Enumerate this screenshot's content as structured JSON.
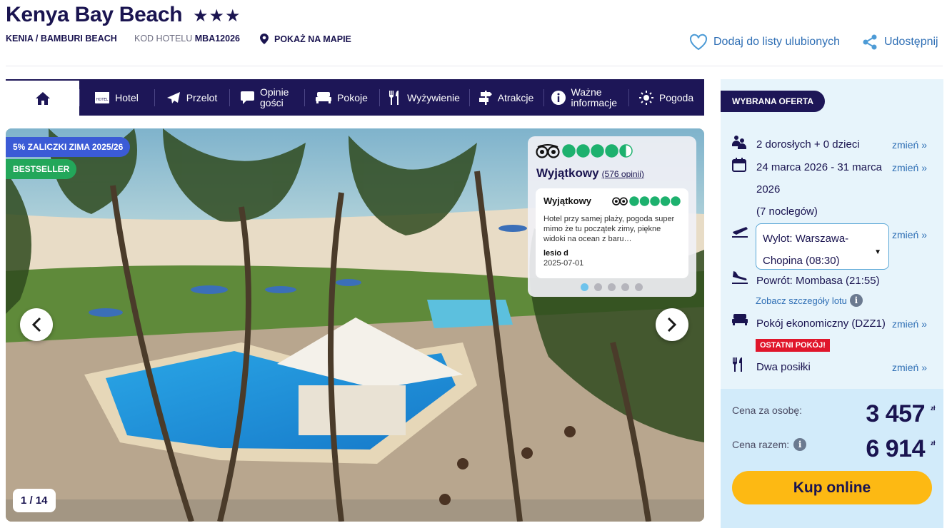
{
  "header": {
    "title": "Kenya Bay Beach",
    "stars": "★★★",
    "location": "KENIA / BAMBURI BEACH",
    "code_label": "KOD HOTELU",
    "code_value": "MBA12026",
    "map_label": "POKAŻ NA MAPIE",
    "favorite_label": "Dodaj do listy ulubionych",
    "share_label": "Udostępnij"
  },
  "tabs": [
    {
      "label": "",
      "icon": "home-icon"
    },
    {
      "label": "Hotel",
      "icon": "hotel-icon"
    },
    {
      "label": "Przelot",
      "icon": "plane-icon"
    },
    {
      "label": "Opinie gości",
      "icon": "chat-icon"
    },
    {
      "label": "Pokoje",
      "icon": "bed-icon"
    },
    {
      "label": "Wyżywienie",
      "icon": "fork-knife-icon"
    },
    {
      "label": "Atrakcje",
      "icon": "signpost-icon"
    },
    {
      "label": "Ważne informacje",
      "icon": "info-icon"
    },
    {
      "label": "Pogoda",
      "icon": "sun-icon"
    }
  ],
  "gallery": {
    "promo_badge": "5% ZALICZKI ZIMA 2025/26",
    "bestseller_badge": "BESTSELLER",
    "counter": "1 / 14"
  },
  "tripadvisor": {
    "rating_label": "Wyjątkowy",
    "reviews_link": "(576 opinii)",
    "score_bubbles": 4.5,
    "review": {
      "title": "Wyjątkowy",
      "score_bubbles": 5,
      "text": "Hotel przy samej plaży, pogoda super mimo że tu początek zimy, piękne widoki na ocean z baru…",
      "author": "lesio d",
      "date": "2025-07-01"
    },
    "dots_total": 5,
    "dots_active": 1
  },
  "offer": {
    "chosen_label": "WYBRANA OFERTA",
    "travelers": "2 dorosłych + 0 dzieci",
    "dates_line1": "24 marca 2026 - 31 marca",
    "dates_line2": "2026",
    "nights": "(7 noclegów)",
    "departure_line1": "Wylot: Warszawa-",
    "departure_line2": "Chopina (08:30)",
    "return": "Powrót: Mombasa (21:55)",
    "flight_details": "Zobacz szczegóły lotu",
    "room": "Pokój ekonomiczny (DZZ1)",
    "last_room": "OSTATNI POKÓJ!",
    "board": "Dwa posiłki",
    "change_label": "zmień »",
    "price_per_person_label": "Cena za osobę:",
    "price_per_person": "3 457",
    "total_label": "Cena razem:",
    "total": "6 914",
    "currency": "zł",
    "buy_label": "Kup online"
  },
  "colors": {
    "navy": "#1d1657",
    "link_blue": "#2f6fb5",
    "panel_bg": "#e7f4fb",
    "price_bg": "#d2ebfa",
    "buy_yellow": "#fdb913",
    "ta_green": "#1db16e",
    "promo_blue": "#3b5bd6",
    "bestseller_green": "#23a75a",
    "last_room_red": "#e0162b"
  }
}
